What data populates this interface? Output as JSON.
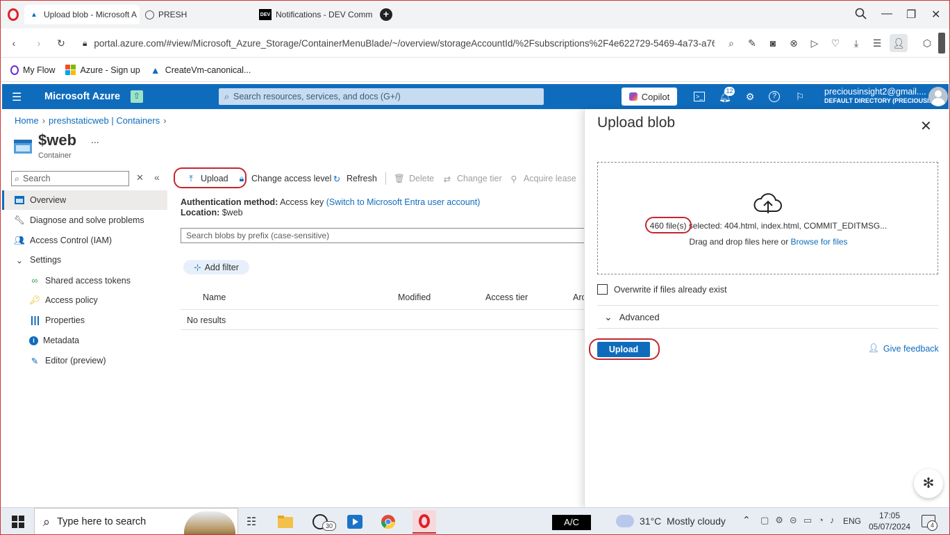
{
  "browser": {
    "tabs": [
      {
        "label": "Upload blob - Microsoft A",
        "icon": "azure-icon"
      },
      {
        "label": "PRESH",
        "icon": "globe-icon"
      },
      {
        "label": "Notifications - DEV Comm",
        "icon": "dev-icon"
      }
    ],
    "url": "portal.azure.com/#view/Microsoft_Azure_Storage/ContainerMenuBlade/~/overview/storageAccountId/%2Fsubscriptions%2F4e622729-5469-4a73-a76f-9a",
    "bookmarks": [
      {
        "label": "My Flow"
      },
      {
        "label": "Azure - Sign up"
      },
      {
        "label": "CreateVm-canonical..."
      }
    ]
  },
  "azure_header": {
    "brand": "Microsoft Azure",
    "search_placeholder": "Search resources, services, and docs (G+/)",
    "copilot_label": "Copilot",
    "notification_count": "12",
    "user_name": "preciousinsight2@gmail....",
    "user_directory": "DEFAULT DIRECTORY (PRECIOUSI..."
  },
  "breadcrumb": {
    "home": "Home",
    "containers": "preshstaticweb | Containers"
  },
  "resource": {
    "title": "$web",
    "subtitle": "Container",
    "more": "..."
  },
  "left_nav": {
    "search_placeholder": "Search",
    "items": [
      {
        "label": "Overview"
      },
      {
        "label": "Diagnose and solve problems"
      },
      {
        "label": "Access Control (IAM)"
      },
      {
        "label": "Settings"
      },
      {
        "label": "Shared access tokens"
      },
      {
        "label": "Access policy"
      },
      {
        "label": "Properties"
      },
      {
        "label": "Metadata"
      },
      {
        "label": "Editor (preview)"
      }
    ]
  },
  "toolbar": {
    "upload": "Upload",
    "change_access": "Change access level",
    "refresh": "Refresh",
    "delete": "Delete",
    "change_tier": "Change tier",
    "acquire_lease": "Acquire lease"
  },
  "overview": {
    "auth_label": "Authentication method:",
    "auth_value": "Access key",
    "auth_link": "(Switch to Microsoft Entra user account)",
    "location_label": "Location:",
    "location_value": "$web",
    "blob_search_placeholder": "Search blobs by prefix (case-sensitive)",
    "add_filter": "Add filter",
    "columns": [
      "Name",
      "Modified",
      "Access tier",
      "Arc"
    ],
    "no_results": "No results"
  },
  "upload_panel": {
    "title": "Upload blob",
    "file_count": "460 file(s)",
    "file_selected": "selected: 404.html, index.html, COMMIT_EDITMSG...",
    "drag_text": "Drag and drop files here",
    "or": "or",
    "browse_link": "Browse for files",
    "overwrite_label": "Overwrite if files already exist",
    "advanced_label": "Advanced",
    "upload_button": "Upload",
    "feedback_label": "Give feedback"
  },
  "taskbar": {
    "search_placeholder": "Type here to search",
    "whatsapp_badge": "30",
    "ac_label": "A/C",
    "weather": "31°C  Mostly cloudy",
    "language": "ENG",
    "time": "17:05",
    "date": "05/07/2024",
    "notification_count": "4"
  },
  "colors": {
    "azure_blue": "#0f6cbd",
    "highlight_red": "#c4262e"
  }
}
